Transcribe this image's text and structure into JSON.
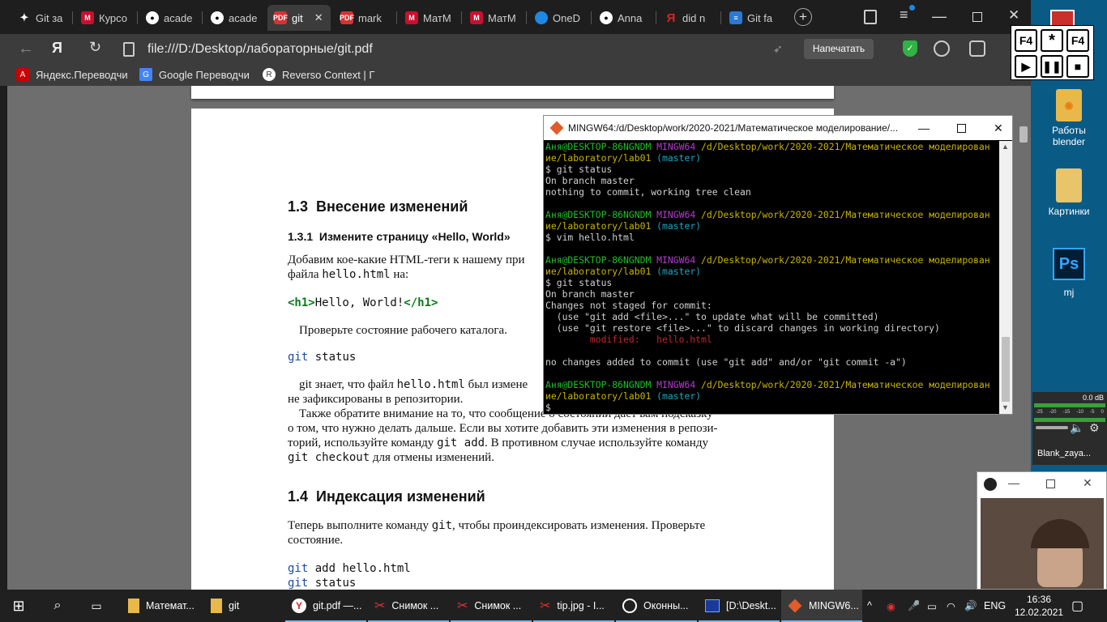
{
  "tabs": [
    {
      "label": "Git за",
      "icon": "sparkle-icon"
    },
    {
      "label": "Курсо",
      "icon": "app-icon"
    },
    {
      "label": "acade",
      "icon": "github-icon"
    },
    {
      "label": "acade",
      "icon": "github-icon"
    },
    {
      "label": "git",
      "icon": "pdf-icon"
    },
    {
      "label": "mark",
      "icon": "pdf-icon"
    },
    {
      "label": "МатМ",
      "icon": "app-icon"
    },
    {
      "label": "МатМ",
      "icon": "app-icon"
    },
    {
      "label": "OneD",
      "icon": "onedrive-icon"
    },
    {
      "label": "Anna",
      "icon": "github-icon"
    },
    {
      "label": "did n",
      "icon": "yandex-icon"
    },
    {
      "label": "Git fa",
      "icon": "stack-icon"
    }
  ],
  "address": {
    "url": "file:///D:/Desktop/лабораторные/git.pdf",
    "yandex_label": "Я",
    "print_label": "Напечатать"
  },
  "bookmarks": [
    "Яндекс.Переводчи",
    "Google Переводчи",
    "Reverso Context | Г"
  ],
  "pdf": {
    "section_num": "1.3",
    "section_title": "Внесение изменений",
    "sub_num": "1.3.1",
    "sub_title": "Измените страницу «Hello, World»",
    "p1a": "Добавим кое-какие HTML-теги к нашему при",
    "p1b_pre": "файла ",
    "p1b_code": "hello.html",
    "p1b_post": " на:",
    "code_open": "<h1>",
    "code_text": "Hello, World!",
    "code_close": "</h1>",
    "p2": "Проверьте состояние рабочего каталога.",
    "cmd_git": "git",
    "cmd_status": "status",
    "p3a_pre": "git знает, что файл ",
    "p3a_code": "hello.html",
    "p3a_post": " был измене",
    "p3b": "не зафиксированы в репозитории.",
    "p4a": "Также обратите внимание на то, что сообщение о состоянии дает вам подсказку",
    "p4b": "о том, что нужно делать дальше. Если вы хотите добавить эти изменения в репози-",
    "p4c_pre": "торий, используйте команду ",
    "p4c_code": "git add",
    "p4c_post": ". В противном случае используйте команду",
    "p4d_code": "git checkout",
    "p4d_post": " для отмены изменений.",
    "section2_num": "1.4",
    "section2_title": "Индексация изменений",
    "p5a_pre": "Теперь выполните команду ",
    "p5a_code": "git",
    "p5a_post": ", чтобы проиндексировать изменения. Проверьте",
    "p5b": "состояние.",
    "c1a": "git",
    "c1b": "add hello.html",
    "c2a": "git",
    "c2b": "status"
  },
  "terminal": {
    "title": "MINGW64:/d/Desktop/work/2020-2021/Математическое моделирование/...",
    "user": "Аня@DESKTOP-86NGNDM",
    "env": "MINGW64",
    "path1": "/d/Desktop/work/2020-2021/Математическое моделирован",
    "path2": "ие/laboratory/lab01",
    "branch": "(master)",
    "l_git_status": "$ git status",
    "l_on_branch": "On branch master",
    "l_nothing": "nothing to commit, working tree clean",
    "l_vim": "$ vim hello.html",
    "l_changes": "Changes not staged for commit:",
    "l_use_add": "  (use \"git add <file>...\" to update what will be committed)",
    "l_use_restore": "  (use \"git restore <file>...\" to discard changes in working directory)",
    "l_modified": "        modified:   hello.html",
    "l_no_changes": "no changes added to commit (use \"git add\" and/or \"git commit -a\")",
    "l_prompt": "$"
  },
  "f4": {
    "b1": "F4",
    "b2": "*",
    "b3": "F4"
  },
  "desktop": [
    {
      "label": "Работы blender",
      "icon": "blender-folder-icon"
    },
    {
      "label": "Картинки",
      "icon": "folder-icon"
    },
    {
      "label": "mj",
      "icon": "photoshop-icon"
    }
  ],
  "audio": {
    "db": "0.0 dB",
    "ticks": [
      "-25",
      "-20",
      "-15",
      "-10",
      "-5",
      "0"
    ],
    "source": "Blank_zaya..."
  },
  "taskbar": [
    {
      "label": "Математ...",
      "icon": "folder-icon"
    },
    {
      "label": "git",
      "icon": "folder-icon"
    },
    {
      "label": "git.pdf —...",
      "icon": "yandex-browser-icon"
    },
    {
      "label": "Снимок ...",
      "icon": "snip-icon"
    },
    {
      "label": "Снимок ...",
      "icon": "snip-icon"
    },
    {
      "label": "tip.jpg - I...",
      "icon": "snip-icon"
    },
    {
      "label": "Оконны...",
      "icon": "obs-icon"
    },
    {
      "label": "[D:\\Deskt...",
      "icon": "far-icon"
    },
    {
      "label": "MINGW6...",
      "icon": "git-icon"
    }
  ],
  "tray": {
    "lang": "ENG",
    "time": "16:36",
    "date": "12.02.2021"
  },
  "colors": {
    "accent": "#76b9ed",
    "terminal_green": "#1fbf2a",
    "terminal_magenta": "#b53bd0",
    "terminal_yellow": "#c8b400",
    "terminal_cyan": "#1aa6c6",
    "terminal_red": "#c3282a"
  }
}
